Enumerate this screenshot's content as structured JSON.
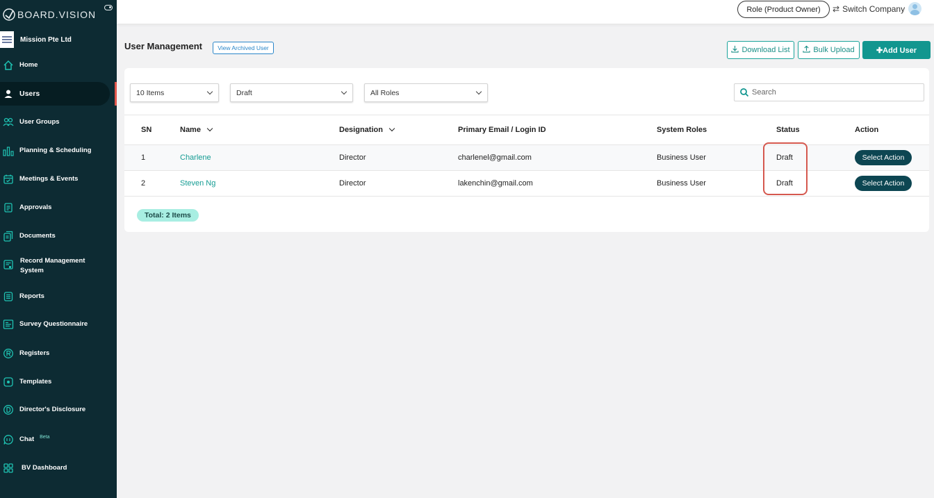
{
  "app": {
    "logo_text": "BOARD.VISION"
  },
  "sidebar": {
    "company_name": "Mission Pte Ltd",
    "items": [
      {
        "label": "Home",
        "icon": "home-icon"
      },
      {
        "label": "Users",
        "icon": "user-icon"
      },
      {
        "label": "User Groups",
        "icon": "user-groups-icon"
      },
      {
        "label": "Planning & Scheduling",
        "icon": "bar-chart-icon"
      },
      {
        "label": "Meetings & Events",
        "icon": "calendar-icon"
      },
      {
        "label": "Approvals",
        "icon": "approval-doc-icon"
      },
      {
        "label": "Documents",
        "icon": "documents-icon"
      },
      {
        "label": "Record Management",
        "label2": "System",
        "icon": "record-management-icon"
      },
      {
        "label": "Reports",
        "icon": "report-icon"
      },
      {
        "label": "Survey Questionnaire",
        "icon": "survey-icon"
      },
      {
        "label": "Registers",
        "icon": "registered-icon"
      },
      {
        "label": "Templates",
        "icon": "template-icon"
      },
      {
        "label": "Director's Disclosure",
        "icon": "disclosure-icon"
      },
      {
        "label": "Chat",
        "badge": "Beta",
        "icon": "chat-icon"
      },
      {
        "label": "BV Dashboard",
        "icon": "dashboard-icon"
      }
    ]
  },
  "topbar": {
    "role_label": "Role (Product Owner)",
    "switch_label": "Switch Company"
  },
  "page": {
    "title": "User Management",
    "archived_label": "View Archived User",
    "download_label": "Download List",
    "bulk_label": "Bulk Upload",
    "add_label": "Add User"
  },
  "filters": {
    "items_value": "10 Items",
    "status_value": "Draft",
    "roles_value": "All Roles",
    "search_placeholder": "Search"
  },
  "table": {
    "columns": [
      "SN",
      "Name",
      "Designation",
      "Primary Email / Login ID",
      "System Roles",
      "Status",
      "Action"
    ],
    "rows": [
      {
        "sn": "1",
        "name": "Charlene",
        "designation": "Director",
        "email": "charlenel@gmail.com",
        "roles": "Business User",
        "status": "Draft",
        "action": "Select Action"
      },
      {
        "sn": "2",
        "name": "Steven Ng",
        "designation": "Director",
        "email": "lakenchin@gmail.com",
        "roles": "Business User",
        "status": "Draft",
        "action": "Select Action"
      }
    ],
    "total": "Total: 2 Items"
  },
  "colors": {
    "sidebar_bg": "#0d2b33",
    "accent": "#12968f",
    "action_button": "#0d4652",
    "highlight": "#d5584e"
  }
}
